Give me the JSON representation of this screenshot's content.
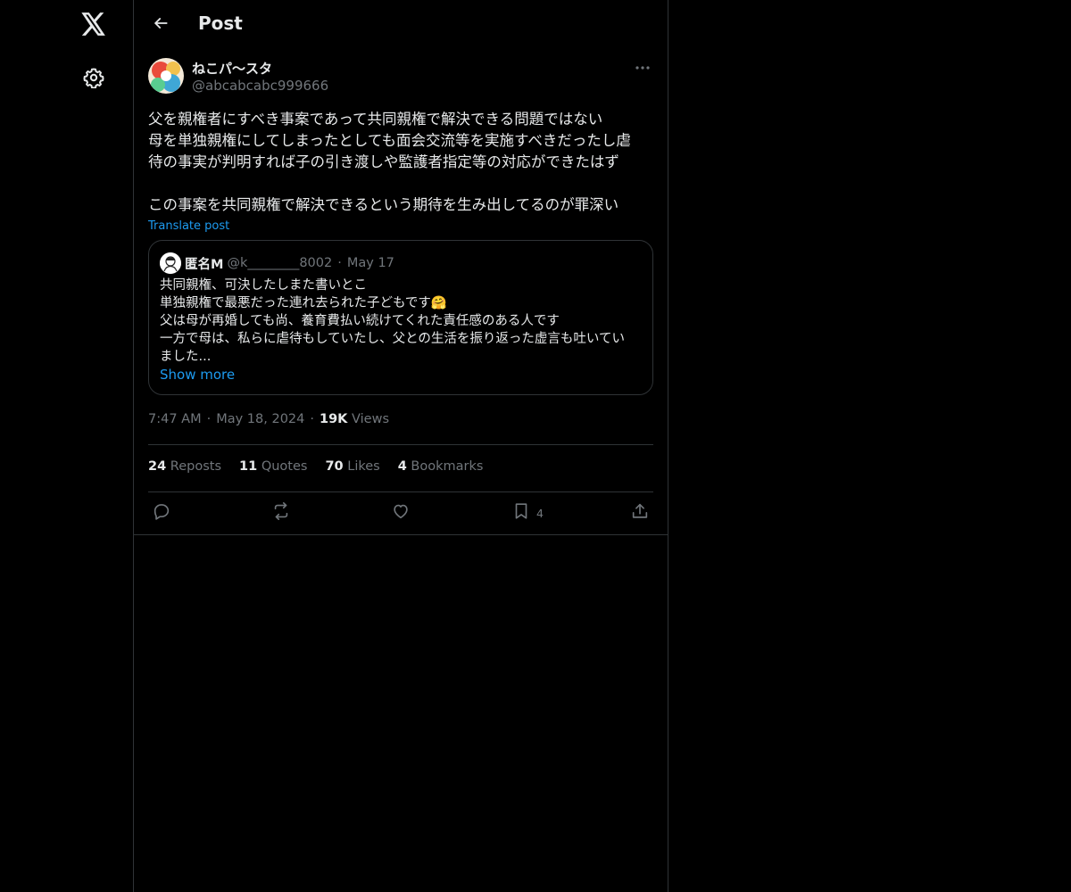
{
  "header": {
    "title": "Post"
  },
  "post": {
    "author_name": "ねこパ〜スタ",
    "author_handle": "@abcabcabc999666",
    "body_lines": [
      "父を親権者にすべき事案であって共同親権で解決できる問題ではない",
      "母を単独親権にしてしまったとしても面会交流等を実施すべきだったし虐",
      "待の事実が判明すれば子の引き渡しや監護者指定等の対応ができたはず",
      "",
      "この事案を共同親権で解決できるという期待を生み出してるのが罪深い"
    ],
    "translate_label": "Translate post",
    "quote": {
      "name": "匿名M",
      "handle": "@k________8002",
      "date": "May 17",
      "lines": [
        "共同親権、可決したしまた書いとこ",
        "単独親権で最悪だった連れ去られた子どもです🤗",
        "父は母が再婚しても尚、養育費払い続けてくれた責任感のある人です",
        "一方で母は、私らに虐待もしていたし、父との生活を振り返った虚言も吐いてい",
        "ました..."
      ],
      "show_more": "Show more"
    },
    "time": "7:47 AM",
    "date": "May 18, 2024",
    "views_count": "19K",
    "views_label": "Views",
    "stats": {
      "reposts_count": "24",
      "reposts_label": "Reposts",
      "quotes_count": "11",
      "quotes_label": "Quotes",
      "likes_count": "70",
      "likes_label": "Likes",
      "bookmarks_count": "4",
      "bookmarks_label": "Bookmarks"
    },
    "actions": {
      "bookmark_count": "4"
    }
  },
  "icons": {
    "nav": [
      "x-logo-icon",
      "settings-icon"
    ],
    "header": [
      "back-arrow-icon"
    ],
    "post": [
      "more-icon"
    ],
    "actions": [
      "reply-icon",
      "repost-icon",
      "like-icon",
      "bookmark-icon",
      "share-icon"
    ]
  },
  "colors": {
    "background": "#000000",
    "text": "#e7e9ea",
    "muted": "#71767b",
    "accent": "#1d9bf0",
    "border": "#2f3336"
  }
}
